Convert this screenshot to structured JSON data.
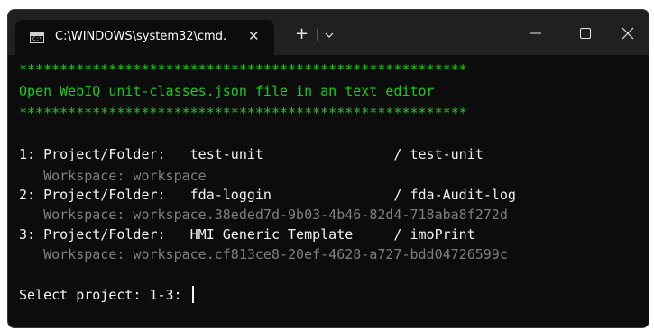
{
  "window": {
    "tab_title": "C:\\WINDOWS\\system32\\cmd.",
    "tab_icon": "cmd-icon",
    "close_tab_glyph": "✕",
    "new_tab_glyph": "+"
  },
  "terminal": {
    "banner_stars": "*******************************************************",
    "banner_text": "Open WebIQ unit-classes.json file in an text editor",
    "projects": [
      {
        "label": "1: Project/Folder:   test-unit                / test-unit",
        "workspace": "   Workspace: workspace"
      },
      {
        "label": "2: Project/Folder:   fda-loggin               / fda-Audit-log",
        "workspace": "   Workspace: workspace.38eded7d-9b03-4b46-82d4-718aba8f272d"
      },
      {
        "label": "3: Project/Folder:   HMI Generic Template     / imoPrint",
        "workspace": "   Workspace: workspace.cf813ce8-20ef-4628-a727-bdd04726599c"
      }
    ],
    "prompt": "Select project: 1-3: "
  },
  "colors": {
    "background": "#0c0c0c",
    "titlebar": "#202020",
    "banner_green": "#13d013",
    "text": "#f2f2f2",
    "muted": "#7f7f7f"
  }
}
